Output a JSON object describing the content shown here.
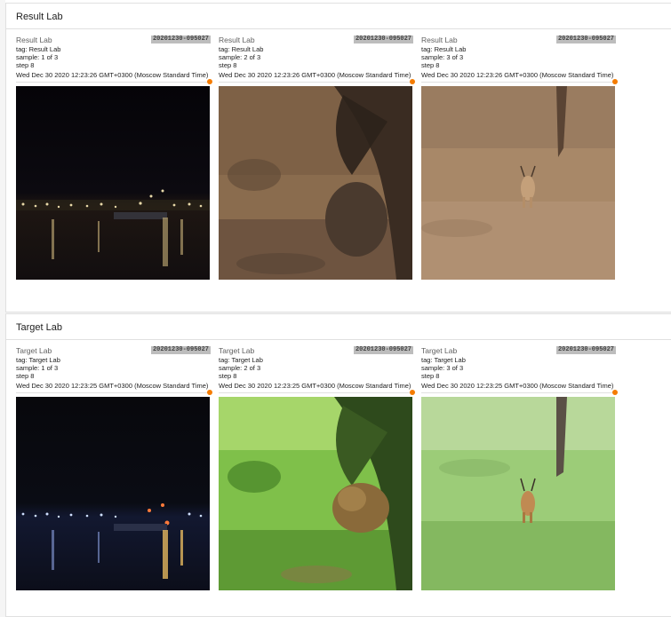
{
  "sections": [
    {
      "title": "Result Lab",
      "cards": [
        {
          "title": "Result Lab",
          "run": "20201230-095027",
          "tag": "tag: Result Lab",
          "sample": "sample: 1 of 3",
          "step": "step 8",
          "time": "Wed Dec 30 2020 12:23:26 GMT+0300 (Moscow Standard Time)",
          "image": "night harbor lights on water (colorized)"
        },
        {
          "title": "Result Lab",
          "run": "20201230-095027",
          "tag": "tag: Result Lab",
          "sample": "sample: 2 of 3",
          "step": "step 8",
          "time": "Wed Dec 30 2020 12:23:26 GMT+0300 (Moscow Standard Time)",
          "image": "lion lying in grass under tree (colorized)"
        },
        {
          "title": "Result Lab",
          "run": "20201230-095027",
          "tag": "tag: Result Lab",
          "sample": "sample: 3 of 3",
          "step": "step 8",
          "time": "Wed Dec 30 2020 12:23:26 GMT+0300 (Moscow Standard Time)",
          "image": "impala standing in tall grass (colorized)"
        }
      ]
    },
    {
      "title": "Target Lab",
      "cards": [
        {
          "title": "Target Lab",
          "run": "20201230-095027",
          "tag": "tag: Target Lab",
          "sample": "sample: 1 of 3",
          "step": "step 8",
          "time": "Wed Dec 30 2020 12:23:25 GMT+0300 (Moscow Standard Time)",
          "image": "night harbor lights on water"
        },
        {
          "title": "Target Lab",
          "run": "20201230-095027",
          "tag": "tag: Target Lab",
          "sample": "sample: 2 of 3",
          "step": "step 8",
          "time": "Wed Dec 30 2020 12:23:25 GMT+0300 (Moscow Standard Time)",
          "image": "lion lying in green grass under tree"
        },
        {
          "title": "Target Lab",
          "run": "20201230-095027",
          "tag": "tag: Target Lab",
          "sample": "sample: 3 of 3",
          "step": "step 8",
          "time": "Wed Dec 30 2020 12:23:25 GMT+0300 (Moscow Standard Time)",
          "image": "impala standing in green grass"
        }
      ]
    }
  ],
  "colors": {
    "slider_accent": "#f57c00",
    "badge_bg": "#bdbdbd"
  }
}
